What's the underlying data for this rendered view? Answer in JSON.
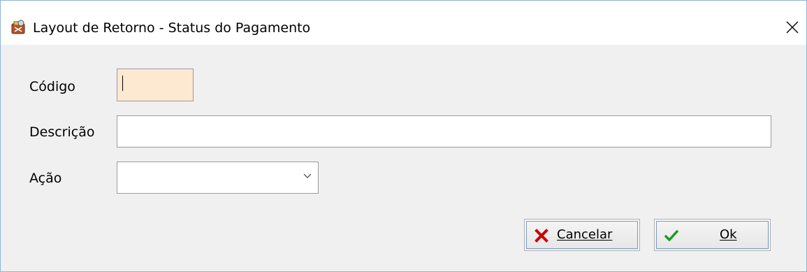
{
  "window": {
    "title": "Layout de Retorno - Status do Pagamento"
  },
  "form": {
    "codigo_label": "Código",
    "codigo_value": "",
    "descricao_label": "Descrição",
    "descricao_value": "",
    "acao_label": "Ação",
    "acao_selected": ""
  },
  "buttons": {
    "cancel_label": "Cancelar",
    "ok_label": "Ok"
  },
  "icons": {
    "app": "app-icon",
    "close": "close-icon",
    "dropdown": "chevron-down-icon",
    "cancel": "red-x-icon",
    "ok": "green-check-icon"
  },
  "colors": {
    "required_field_bg": "#fde8d2",
    "cancel_icon": "#cc0000",
    "ok_icon": "#1a9e1a"
  }
}
